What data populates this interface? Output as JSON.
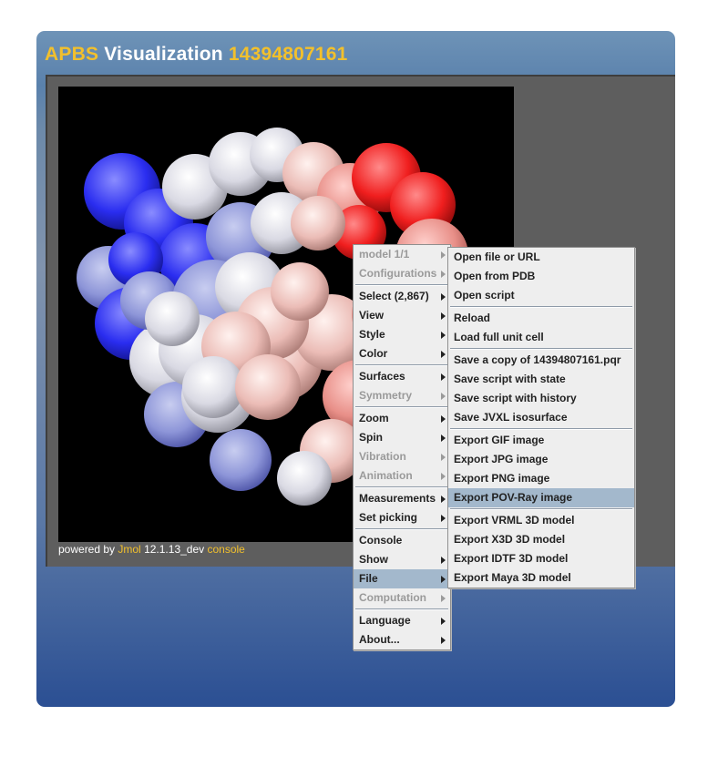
{
  "header": {
    "title_prefix": "APBS",
    "title_middle": "Visualization",
    "title_id": "14394807161"
  },
  "footer": {
    "powered_by": "powered by",
    "jmol": "Jmol",
    "version": "12.1.13_dev",
    "console": "console"
  },
  "colors": {
    "accent": "#f2c02c",
    "highlight": "#a3b8cc",
    "positive": "#1515ff",
    "negative": "#ff0000"
  },
  "main_menu": {
    "model": "model 1/1",
    "configurations": "Configurations",
    "select": "Select (2,867)",
    "view": "View",
    "style": "Style",
    "color": "Color",
    "surfaces": "Surfaces",
    "symmetry": "Symmetry",
    "zoom": "Zoom",
    "spin": "Spin",
    "vibration": "Vibration",
    "animation": "Animation",
    "measurements": "Measurements",
    "set_picking": "Set picking",
    "console": "Console",
    "show": "Show",
    "file": "File",
    "computation": "Computation",
    "language": "Language",
    "about": "About..."
  },
  "file_menu": {
    "open_file": "Open file or URL",
    "open_pdb": "Open from PDB",
    "open_script": "Open script",
    "reload": "Reload",
    "load_unit_cell": "Load full unit cell",
    "save_copy": "Save a copy of 14394807161.pqr",
    "save_state": "Save script with state",
    "save_history": "Save script with history",
    "save_jvxl": "Save JVXL isosurface",
    "export_gif": "Export GIF image",
    "export_jpg": "Export JPG image",
    "export_png": "Export PNG image",
    "export_povray": "Export POV-Ray image",
    "export_vrml": "Export VRML 3D model",
    "export_x3d": "Export X3D 3D model",
    "export_idtf": "Export IDTF 3D model",
    "export_maya": "Export Maya 3D model"
  }
}
